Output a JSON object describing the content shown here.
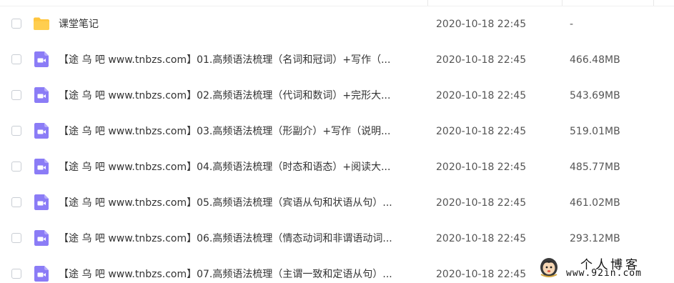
{
  "colors": {
    "folder": "#FFC53D",
    "video": "#8B7CF6",
    "text": "#333333",
    "muted": "#555555"
  },
  "files": [
    {
      "icon": "folder-icon",
      "name": "课堂笔记",
      "date": "2020-10-18 22:45",
      "size": "-"
    },
    {
      "icon": "video-file-icon",
      "name": "【途 乌 吧 www.tnbzs.com】01.高频语法梳理（名词和冠词）+写作（...",
      "date": "2020-10-18 22:45",
      "size": "466.48MB"
    },
    {
      "icon": "video-file-icon",
      "name": "【途 乌 吧 www.tnbzs.com】02.高频语法梳理（代词和数词）+完形大...",
      "date": "2020-10-18 22:45",
      "size": "543.69MB"
    },
    {
      "icon": "video-file-icon",
      "name": "【途 乌 吧 www.tnbzs.com】03.高频语法梳理（形副介）+写作（说明...",
      "date": "2020-10-18 22:45",
      "size": "519.01MB"
    },
    {
      "icon": "video-file-icon",
      "name": "【途 乌 吧 www.tnbzs.com】04.高频语法梳理（时态和语态）+阅读大...",
      "date": "2020-10-18 22:45",
      "size": "485.77MB"
    },
    {
      "icon": "video-file-icon",
      "name": "【途 乌 吧 www.tnbzs.com】05.高频语法梳理（宾语从句和状语从句）...",
      "date": "2020-10-18 22:45",
      "size": "461.02MB"
    },
    {
      "icon": "video-file-icon",
      "name": "【途 乌 吧 www.tnbzs.com】06.高频语法梳理（情态动词和非谓语动词...",
      "date": "2020-10-18 22:45",
      "size": "293.12MB"
    },
    {
      "icon": "video-file-icon",
      "name": "【途 乌 吧 www.tnbzs.com】07.高频语法梳理（主谓一致和定语从句）...",
      "date": "2020-10-18 22:45",
      "size": ""
    }
  ],
  "watermark": {
    "title": "个人博客",
    "url": "www.92in.com"
  }
}
